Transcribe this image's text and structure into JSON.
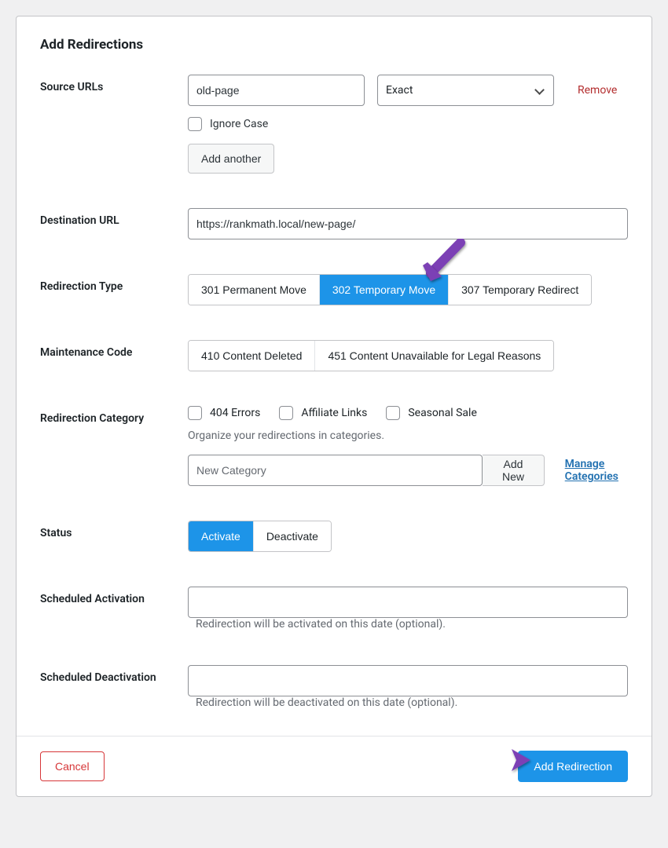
{
  "title": "Add Redirections",
  "labels": {
    "source_urls": "Source URLs",
    "destination_url": "Destination URL",
    "redirection_type": "Redirection Type",
    "maintenance_code": "Maintenance Code",
    "redirection_category": "Redirection Category",
    "status": "Status",
    "scheduled_activation": "Scheduled Activation",
    "scheduled_deactivation": "Scheduled Deactivation"
  },
  "source": {
    "value": "old-page",
    "match_type": "Exact",
    "remove": "Remove",
    "ignore_case": "Ignore Case",
    "add_another": "Add another"
  },
  "destination": {
    "value": "https://rankmath.local/new-page/"
  },
  "redirection_type": {
    "options": [
      "301 Permanent Move",
      "302 Temporary Move",
      "307 Temporary Redirect"
    ],
    "selected_index": 1
  },
  "maintenance_code": {
    "options": [
      "410 Content Deleted",
      "451 Content Unavailable for Legal Reasons"
    ]
  },
  "categories": {
    "items": [
      "404 Errors",
      "Affiliate Links",
      "Seasonal Sale"
    ],
    "help": "Organize your redirections in categories.",
    "new_placeholder": "New Category",
    "add_new": "Add New",
    "manage": "Manage Categories"
  },
  "status": {
    "options": [
      "Activate",
      "Deactivate"
    ],
    "selected_index": 0
  },
  "activation_help": "Redirection will be activated on this date (optional).",
  "deactivation_help": "Redirection will be deactivated on this date (optional).",
  "footer": {
    "cancel": "Cancel",
    "submit": "Add Redirection"
  }
}
